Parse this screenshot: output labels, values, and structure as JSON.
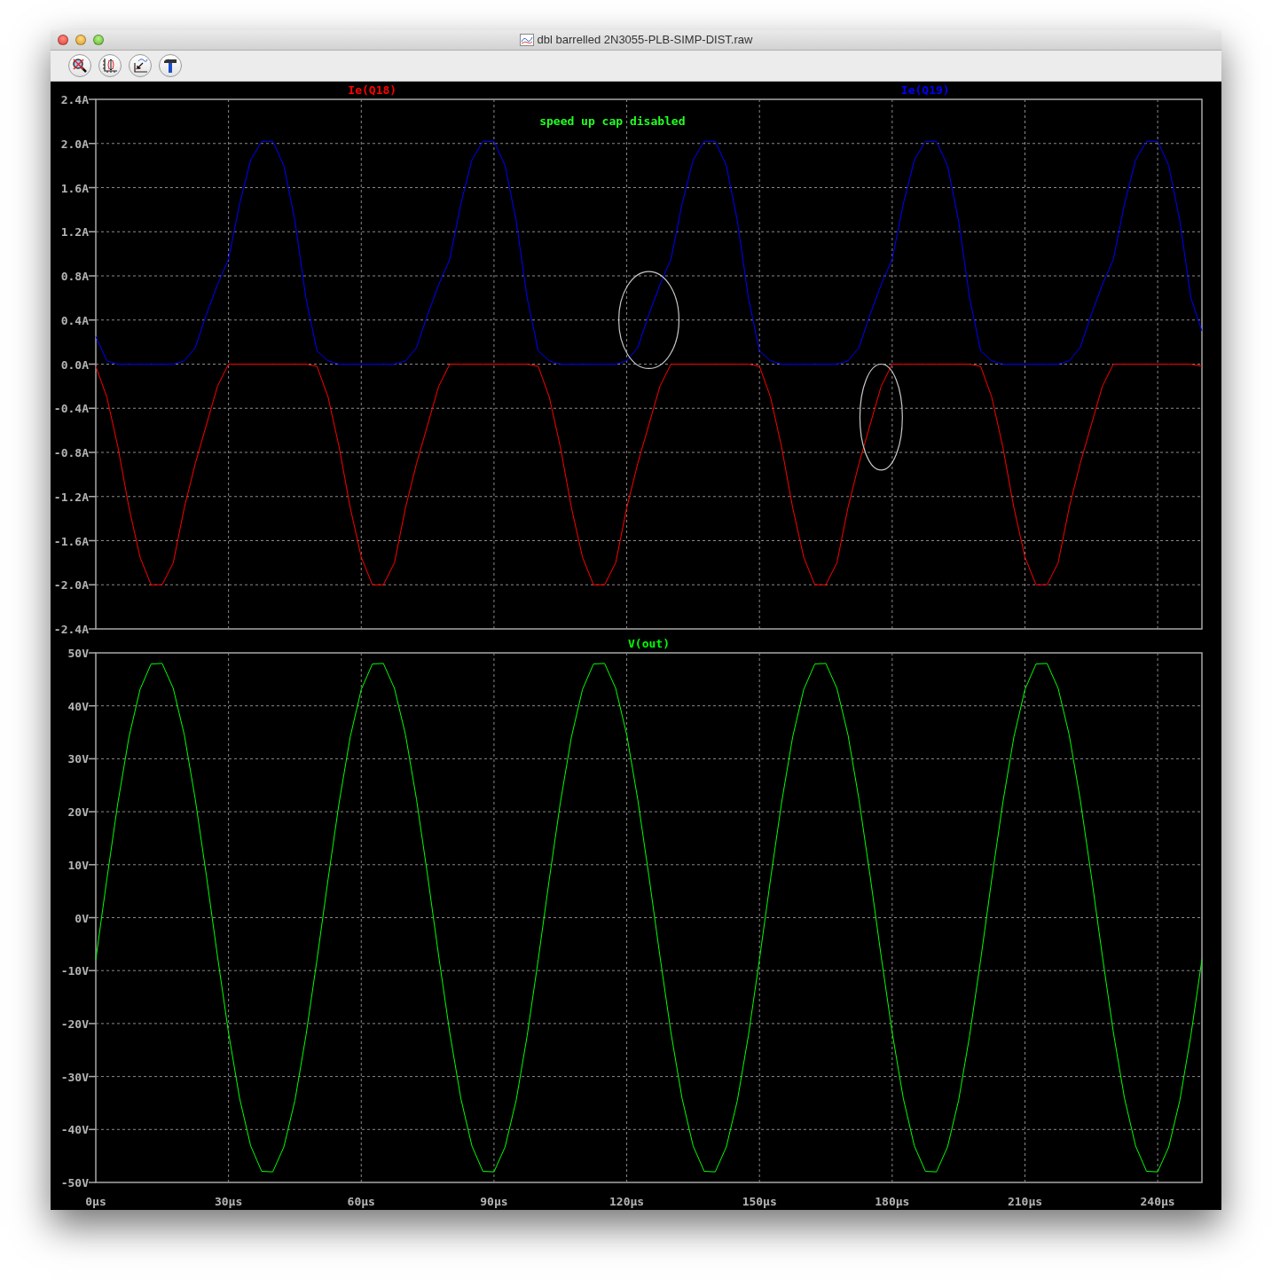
{
  "window": {
    "title": "dbl barrelled 2N3055-PLB-SIMP-DIST.raw"
  },
  "panes": [
    {
      "chart_data": {
        "type": "line",
        "xlim": [
          0,
          250
        ],
        "ylim": [
          -2.4,
          2.4
        ],
        "grid": true,
        "yticks": [
          {
            "value": 2.4,
            "label": "2.4A"
          },
          {
            "value": 2.0,
            "label": "2.0A"
          },
          {
            "value": 1.6,
            "label": "1.6A"
          },
          {
            "value": 1.2,
            "label": "1.2A"
          },
          {
            "value": 0.8,
            "label": "0.8A"
          },
          {
            "value": 0.4,
            "label": "0.4A"
          },
          {
            "value": 0,
            "label": "0.0A"
          },
          {
            "value": -0.4,
            "label": "-0.4A"
          },
          {
            "value": -0.8,
            "label": "-0.8A"
          },
          {
            "value": -1.2,
            "label": "-1.2A"
          },
          {
            "value": -1.6,
            "label": "-1.6A"
          },
          {
            "value": -2.0,
            "label": "-2.0A"
          },
          {
            "value": -2.4,
            "label": "-2.4A"
          }
        ],
        "x": [
          0,
          2.5,
          5,
          7.5,
          10,
          12.5,
          15,
          17.5,
          20,
          22.5,
          25,
          27.5,
          30,
          32.5,
          35,
          37.5,
          40,
          42.5,
          45,
          47.5,
          50,
          52.5,
          55,
          57.5,
          60,
          62.5,
          65,
          67.5,
          70,
          72.5,
          75,
          77.5,
          80,
          82.5,
          85,
          87.5,
          90,
          92.5,
          95,
          97.5,
          100,
          102.5,
          105,
          107.5,
          110,
          112.5,
          115,
          117.5,
          120,
          122.5,
          125,
          127.5,
          130,
          132.5,
          135,
          137.5,
          140,
          142.5,
          145,
          147.5,
          150,
          152.5,
          155,
          157.5,
          160,
          162.5,
          165,
          167.5,
          170,
          172.5,
          175,
          177.5,
          180,
          182.5,
          185,
          187.5,
          190,
          192.5,
          195,
          197.5,
          200,
          202.5,
          205,
          207.5,
          210,
          212.5,
          215,
          217.5,
          220,
          222.5,
          225,
          227.5,
          230,
          232.5,
          235,
          237.5,
          240,
          242.5,
          245,
          247.5,
          250
        ],
        "series": [
          {
            "name": "Ie(Q18)",
            "color": "#ff0000",
            "values": [
              -0.02,
              -0.3,
              -0.75,
              -1.3,
              -1.75,
              -2.0,
              -2.0,
              -1.8,
              -1.3,
              -0.9,
              -0.55,
              -0.2,
              0,
              0,
              0,
              0,
              0,
              0,
              0,
              0,
              -0.02,
              -0.3,
              -0.75,
              -1.3,
              -1.75,
              -2.0,
              -2.0,
              -1.8,
              -1.3,
              -0.9,
              -0.55,
              -0.2,
              0,
              0,
              0,
              0,
              0,
              0,
              0,
              0,
              -0.02,
              -0.3,
              -0.75,
              -1.3,
              -1.75,
              -2.0,
              -2.0,
              -1.8,
              -1.3,
              -0.9,
              -0.55,
              -0.2,
              0,
              0,
              0,
              0,
              0,
              0,
              0,
              0,
              -0.02,
              -0.3,
              -0.75,
              -1.3,
              -1.75,
              -2.0,
              -2.0,
              -1.8,
              -1.3,
              -0.9,
              -0.55,
              -0.2,
              0,
              0,
              0,
              0,
              0,
              0,
              0,
              0,
              -0.02,
              -0.3,
              -0.75,
              -1.3,
              -1.75,
              -2.0,
              -2.0,
              -1.8,
              -1.3,
              -0.9,
              -0.55,
              -0.2,
              0,
              0,
              0,
              0,
              0,
              0,
              0,
              0,
              -0.02
            ]
          },
          {
            "name": "Ie(Q19)",
            "color": "#0000ff",
            "values": [
              0.25,
              0.03,
              0,
              0,
              0,
              0,
              0,
              0,
              0.03,
              0.15,
              0.45,
              0.72,
              0.95,
              1.45,
              1.85,
              2.02,
              2.02,
              1.8,
              1.3,
              0.6,
              0.12,
              0.03,
              0,
              0,
              0,
              0,
              0,
              0,
              0.03,
              0.15,
              0.45,
              0.72,
              0.95,
              1.45,
              1.85,
              2.02,
              2.02,
              1.8,
              1.3,
              0.6,
              0.12,
              0.03,
              0,
              0,
              0,
              0,
              0,
              0,
              0.03,
              0.15,
              0.45,
              0.72,
              0.95,
              1.45,
              1.85,
              2.02,
              2.02,
              1.8,
              1.3,
              0.6,
              0.12,
              0.03,
              0,
              0,
              0,
              0,
              0,
              0,
              0.03,
              0.15,
              0.45,
              0.72,
              0.95,
              1.45,
              1.85,
              2.02,
              2.02,
              1.8,
              1.3,
              0.6,
              0.12,
              0.03,
              0,
              0,
              0,
              0,
              0,
              0,
              0.03,
              0.15,
              0.45,
              0.72,
              0.95,
              1.45,
              1.85,
              2.02,
              2.02,
              1.8,
              1.3,
              0.6,
              0.3
            ]
          }
        ],
        "annotations": [
          "speed up cap disabled"
        ]
      }
    },
    {
      "chart_data": {
        "type": "line",
        "xlim": [
          0,
          250
        ],
        "ylim": [
          -50,
          50
        ],
        "grid": true,
        "xticks": [
          {
            "value": 0,
            "label": "0µs"
          },
          {
            "value": 30,
            "label": "30µs"
          },
          {
            "value": 60,
            "label": "60µs"
          },
          {
            "value": 90,
            "label": "90µs"
          },
          {
            "value": 120,
            "label": "120µs"
          },
          {
            "value": 150,
            "label": "150µs"
          },
          {
            "value": 180,
            "label": "180µs"
          },
          {
            "value": 210,
            "label": "210µs"
          },
          {
            "value": 240,
            "label": "240µs"
          }
        ],
        "yticks": [
          {
            "value": 50,
            "label": "50V"
          },
          {
            "value": 40,
            "label": "40V"
          },
          {
            "value": 30,
            "label": "30V"
          },
          {
            "value": 20,
            "label": "20V"
          },
          {
            "value": 10,
            "label": "10V"
          },
          {
            "value": 0,
            "label": "0V"
          },
          {
            "value": -10,
            "label": "-10V"
          },
          {
            "value": -20,
            "label": "-20V"
          },
          {
            "value": -30,
            "label": "-30V"
          },
          {
            "value": -40,
            "label": "-40V"
          },
          {
            "value": -50,
            "label": "-50V"
          }
        ],
        "x": [
          0,
          2.5,
          5,
          7.5,
          10,
          12.5,
          15,
          17.5,
          20,
          22.5,
          25,
          27.5,
          30,
          32.5,
          35,
          37.5,
          40,
          42.5,
          45,
          47.5,
          50,
          52.5,
          55,
          57.5,
          60,
          62.5,
          65,
          67.5,
          70,
          72.5,
          75,
          77.5,
          80,
          82.5,
          85,
          87.5,
          90,
          92.5,
          95,
          97.5,
          100,
          102.5,
          105,
          107.5,
          110,
          112.5,
          115,
          117.5,
          120,
          122.5,
          125,
          127.5,
          130,
          132.5,
          135,
          137.5,
          140,
          142.5,
          145,
          147.5,
          150,
          152.5,
          155,
          157.5,
          160,
          162.5,
          165,
          167.5,
          170,
          172.5,
          175,
          177.5,
          180,
          182.5,
          185,
          187.5,
          190,
          192.5,
          195,
          197.5,
          200,
          202.5,
          205,
          207.5,
          210,
          212.5,
          215,
          217.5,
          220,
          222.5,
          225,
          227.5,
          230,
          232.5,
          235,
          237.5,
          240,
          242.5,
          245,
          247.5,
          250
        ],
        "series": [
          {
            "name": "V(out)",
            "color": "#00ff00",
            "values": [
              -7.9,
              7.3,
              21.7,
              34.1,
              43.1,
              47.9,
              48.0,
              43.3,
              34.5,
              22.3,
              7.9,
              -7.3,
              -21.7,
              -34.1,
              -43.1,
              -47.9,
              -48.0,
              -43.3,
              -34.5,
              -22.3,
              -7.9,
              7.3,
              21.7,
              34.1,
              43.1,
              47.9,
              48.0,
              43.3,
              34.5,
              22.3,
              7.9,
              -7.3,
              -21.7,
              -34.1,
              -43.1,
              -47.9,
              -48.0,
              -43.3,
              -34.5,
              -22.3,
              -7.9,
              7.3,
              21.7,
              34.1,
              43.1,
              47.9,
              48.0,
              43.3,
              34.5,
              22.3,
              7.9,
              -7.3,
              -21.7,
              -34.1,
              -43.1,
              -47.9,
              -48.0,
              -43.3,
              -34.5,
              -22.3,
              -7.9,
              7.3,
              21.7,
              34.1,
              43.1,
              47.9,
              48.0,
              43.3,
              34.5,
              22.3,
              7.9,
              -7.3,
              -21.7,
              -34.1,
              -43.1,
              -47.9,
              -48.0,
              -43.3,
              -34.5,
              -22.3,
              -7.9,
              7.3,
              21.7,
              34.1,
              43.1,
              47.9,
              48.0,
              43.3,
              34.5,
              22.3,
              7.9,
              -7.3,
              -21.7,
              -34.1,
              -43.1,
              -47.9,
              -48.0,
              -43.3,
              -34.5,
              -22.3,
              -7.9
            ]
          }
        ]
      }
    }
  ]
}
